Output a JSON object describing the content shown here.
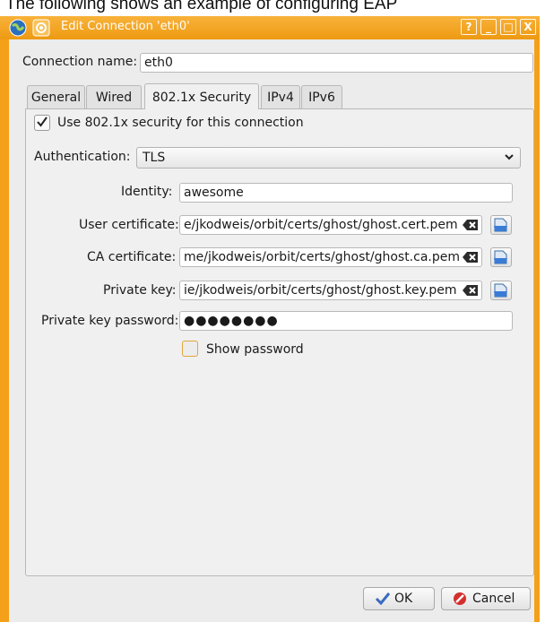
{
  "caption": "The following shows an example of configuring EAP",
  "window": {
    "title": "Edit Connection 'eth0'",
    "buttons": {
      "help": "?",
      "minimize": "_",
      "maximize": "□",
      "close": "X"
    }
  },
  "connection_name": {
    "label": "Connection name:",
    "value": "eth0"
  },
  "tabs": [
    {
      "label": "General"
    },
    {
      "label": "Wired"
    },
    {
      "label": "802.1x Security"
    },
    {
      "label": "IPv4"
    },
    {
      "label": "IPv6"
    }
  ],
  "security": {
    "use_8021x_label": "Use 802.1x security for this connection",
    "use_8021x_checked": true,
    "authentication_label": "Authentication:",
    "authentication_value": "TLS",
    "identity_label": "Identity:",
    "identity_value": "awesome",
    "user_cert_label": "User certificate:",
    "user_cert_value": "e/jkodweis/orbit/certs/ghost/ghost.cert.pem",
    "ca_cert_label": "CA certificate:",
    "ca_cert_value": "me/jkodweis/orbit/certs/ghost/ghost.ca.pem",
    "private_key_label": "Private key:",
    "private_key_value": "ie/jkodweis/orbit/certs/ghost/ghost.key.pem",
    "private_key_password_label": "Private key password:",
    "private_key_password_value": "●●●●●●●●",
    "show_password_label": "Show password",
    "show_password_checked": false
  },
  "footer": {
    "ok_label": "OK",
    "cancel_label": "Cancel"
  },
  "colors": {
    "title_bar": "#f4a019",
    "dialog_bg": "#ececec"
  }
}
